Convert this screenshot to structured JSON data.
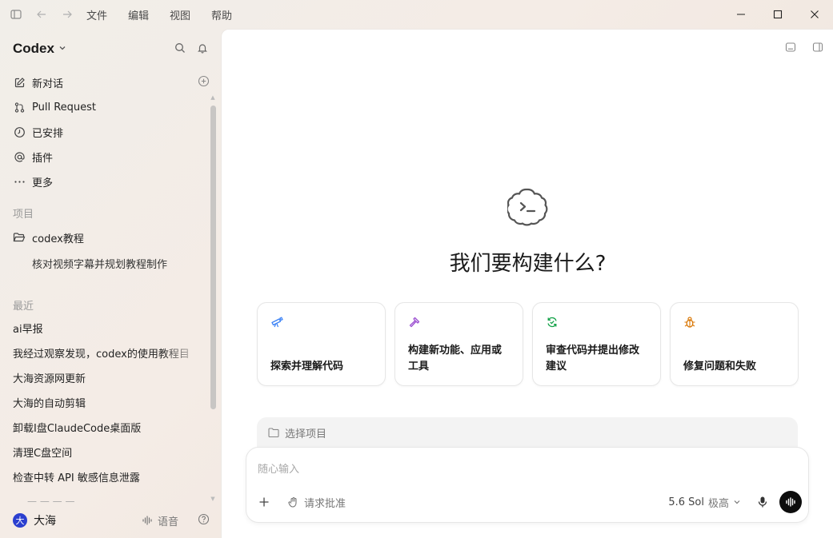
{
  "menu": [
    "文件",
    "编辑",
    "视图",
    "帮助"
  ],
  "sidebar": {
    "brand": "Codex",
    "nav": [
      {
        "label": "新对话",
        "icon": "edit-icon"
      },
      {
        "label": "Pull Request",
        "icon": "pull-request-icon"
      },
      {
        "label": "已安排",
        "icon": "clock-icon"
      },
      {
        "label": "插件",
        "icon": "at-icon"
      },
      {
        "label": "更多",
        "icon": "more-icon"
      }
    ],
    "projects_label": "项目",
    "project": "codex教程",
    "project_thread": "核对视频字幕并规划教程制作",
    "recent_label": "最近",
    "recent": [
      "ai早报",
      "我经过观察发现，codex的使用教程目",
      "大海资源网更新",
      "大海的自动剪辑",
      "卸载I盘ClaudeCode桌面版",
      "清理C盘空间",
      "检查中转 API 敏感信息泄露"
    ],
    "user": {
      "avatar": "大",
      "name": "大海"
    },
    "voice_label": "语音"
  },
  "main": {
    "title": "我们要构建什么?",
    "cards": [
      {
        "label": "探索并理解代码",
        "icon": "telescope-icon",
        "color": "#3b82f6"
      },
      {
        "label": "构建新功能、应用或工具",
        "icon": "hammer-icon",
        "color": "#9b4fd0"
      },
      {
        "label": "审查代码并提出修改建议",
        "icon": "refresh-check-icon",
        "color": "#16a34a"
      },
      {
        "label": "修复问题和失败",
        "icon": "bug-icon",
        "color": "#d97706"
      }
    ],
    "project_selector": "选择项目",
    "composer": {
      "placeholder": "随心输入",
      "approval": "请求批准",
      "model": "5.6 Sol",
      "level": "极高"
    }
  }
}
